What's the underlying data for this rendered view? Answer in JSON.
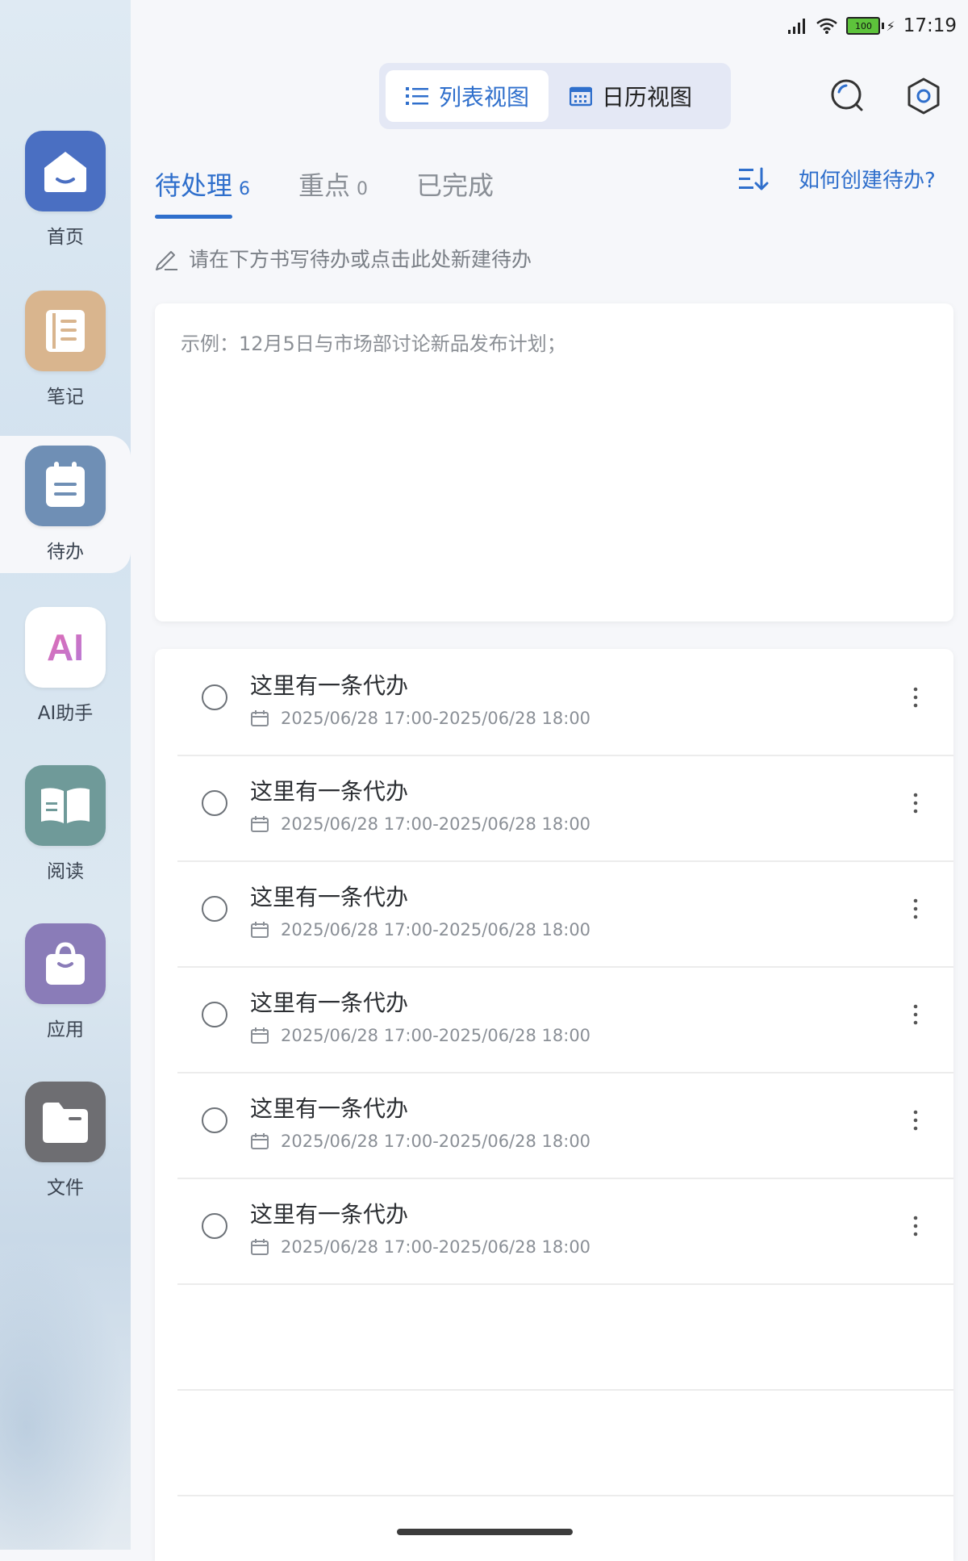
{
  "status_bar": {
    "battery": "100",
    "time": "17:19"
  },
  "sidebar": {
    "items": [
      {
        "label": "首页"
      },
      {
        "label": "笔记"
      },
      {
        "label": "待办"
      },
      {
        "label": "AI助手",
        "icon_text": "AI"
      },
      {
        "label": "阅读"
      },
      {
        "label": "应用"
      },
      {
        "label": "文件"
      }
    ]
  },
  "view_switch": {
    "list_label": "列表视图",
    "calendar_label": "日历视图"
  },
  "tabs": {
    "pending": {
      "label": "待处理",
      "count": "6"
    },
    "important": {
      "label": "重点",
      "count": "0"
    },
    "done": {
      "label": "已完成"
    }
  },
  "help_link": "如何创建待办?",
  "hint": "请在下方书写待办或点击此处新建待办",
  "input": {
    "placeholder": "示例：12月5日与市场部讨论新品发布计划；"
  },
  "todos": [
    {
      "title": "这里有一条代办",
      "time": "2025/06/28 17:00-2025/06/28 18:00"
    },
    {
      "title": "这里有一条代办",
      "time": "2025/06/28 17:00-2025/06/28 18:00"
    },
    {
      "title": "这里有一条代办",
      "time": "2025/06/28 17:00-2025/06/28 18:00"
    },
    {
      "title": "这里有一条代办",
      "time": "2025/06/28 17:00-2025/06/28 18:00"
    },
    {
      "title": "这里有一条代办",
      "time": "2025/06/28 17:00-2025/06/28 18:00"
    },
    {
      "title": "这里有一条代办",
      "time": "2025/06/28 17:00-2025/06/28 18:00"
    }
  ],
  "colors": {
    "accent": "#2f6fcc",
    "home_icon": "#4a6fc2",
    "notes_icon": "#d9b58e",
    "todo_icon": "#6f8fb5",
    "ai_icon": "#ffffff",
    "read_icon": "#6f9a99",
    "apps_icon": "#8a7cb8",
    "files_icon": "#6e6e72"
  }
}
